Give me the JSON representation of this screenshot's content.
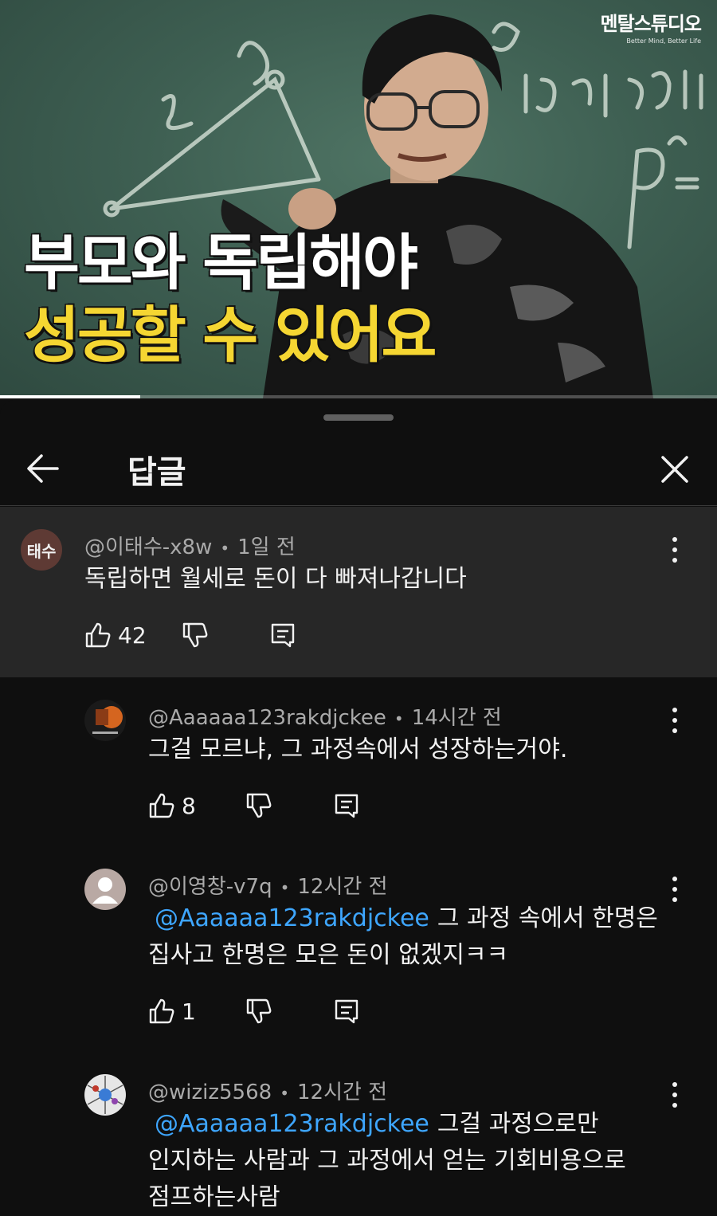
{
  "video": {
    "channel_name": "멘탈스튜디오",
    "channel_tagline": "Better Mind, Better Life",
    "caption_line1": "부모와 독립해야",
    "caption_line2": "성공할 수 있어요",
    "progress": 0.195
  },
  "sheet": {
    "title": "답글"
  },
  "parent_comment": {
    "avatar_text": "태수",
    "author": "@이태수-x8w",
    "time": "1일 전",
    "text": "독립하면 월세로 돈이 다 빠져나갑니다",
    "likes": "42"
  },
  "replies": [
    {
      "author": "@Aaaaaa123rakdjckee",
      "time": "14시간 전",
      "lines": [
        "그걸 모르냐, 그 과정속에서 성장하는거야."
      ],
      "likes": "8"
    },
    {
      "author": "@이영창-v7q",
      "time": "12시간 전",
      "mention": "@Aaaaaa123rakdjckee",
      "lines": [
        "그 과정 속에서 한명은",
        "집사고 한명은 모은 돈이 없겠지ㅋㅋ"
      ],
      "likes": "1"
    },
    {
      "author": "@wiziz5568",
      "time": "12시간 전",
      "mention": "@Aaaaaa123rakdjckee",
      "lines": [
        "그걸 과정으로만",
        "인지하는 사람과 그 과정에서 얻는 기회비용으로",
        "점프하는사람"
      ]
    }
  ]
}
